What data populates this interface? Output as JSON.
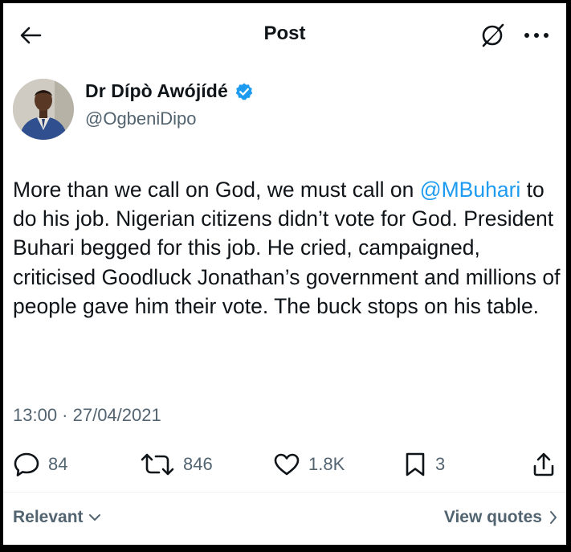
{
  "header": {
    "title": "Post"
  },
  "author": {
    "name": "Dr Dípò Awójídé",
    "handle": "@OgbeniDipo",
    "verified": true
  },
  "tweet": {
    "text_before_mention": "More than we call on God, we must call on",
    "mention": "@MBuhari",
    "text_after_mention": " to do his job. Nigerian citizens didn’t vote for God. President Buhari begged for this job. He cried, campaigned, criticised Goodluck Jonathan’s government and millions of people gave him their vote. The buck stops on his table.",
    "timestamp": "13:00 · 27/04/2021"
  },
  "actions": {
    "replies": "84",
    "reposts": "846",
    "likes": "1.8K",
    "bookmarks": "3"
  },
  "footer": {
    "sort_label": "Relevant",
    "view_quotes_label": "View quotes"
  },
  "colors": {
    "accent": "#1d9bf0",
    "text": "#0f1419",
    "muted": "#536471"
  },
  "icons": {
    "back": "arrow-left-icon",
    "grok": "grok-icon",
    "more": "more-horizontal-icon",
    "verified": "verified-badge-icon",
    "reply": "reply-bubble-icon",
    "repost": "repost-icon",
    "like": "heart-icon",
    "bookmark": "bookmark-icon",
    "share": "share-icon"
  }
}
